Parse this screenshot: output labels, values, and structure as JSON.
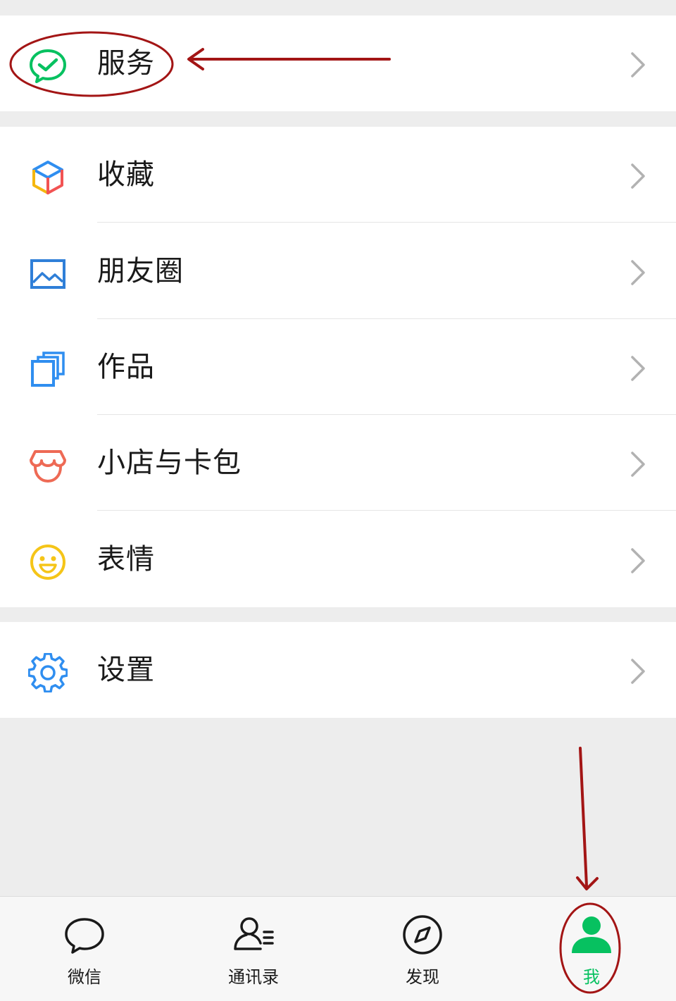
{
  "colors": {
    "background": "#ededed",
    "card": "#ffffff",
    "text": "#1a1a1a",
    "divider": "#e5e5e5",
    "chevron": "#b2b2b2",
    "accent_green": "#07c160",
    "annotation_red": "#a31515"
  },
  "menu": {
    "services": {
      "label": "服务",
      "icon": "wechat-pay-check-icon"
    },
    "favorites": {
      "label": "收藏",
      "icon": "cube-icon"
    },
    "moments": {
      "label": "朋友圈",
      "icon": "picture-icon"
    },
    "works": {
      "label": "作品",
      "icon": "stacked-cards-icon"
    },
    "shop_cards": {
      "label": "小店与卡包",
      "icon": "shop-awning-icon"
    },
    "stickers": {
      "label": "表情",
      "icon": "smiley-icon"
    },
    "settings": {
      "label": "设置",
      "icon": "gear-icon"
    }
  },
  "tabbar": {
    "active": "me",
    "tabs": [
      {
        "id": "chats",
        "label": "微信",
        "icon": "chat-bubble-icon"
      },
      {
        "id": "contacts",
        "label": "通讯录",
        "icon": "contacts-icon"
      },
      {
        "id": "discover",
        "label": "发现",
        "icon": "compass-icon"
      },
      {
        "id": "me",
        "label": "我",
        "icon": "person-icon"
      }
    ]
  }
}
